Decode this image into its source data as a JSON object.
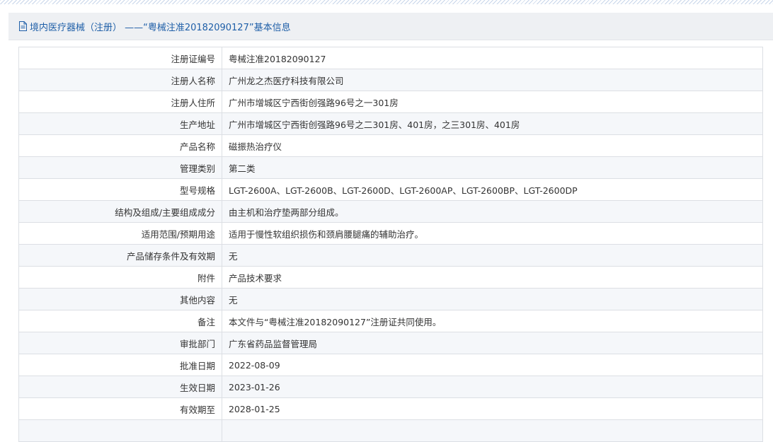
{
  "header": {
    "title": "境内医疗器械（注册） ——“粤械注准20182090127”基本信息"
  },
  "rows": [
    {
      "label": "注册证编号",
      "value": "粤械注准20182090127"
    },
    {
      "label": "注册人名称",
      "value": "广州龙之杰医疗科技有限公司"
    },
    {
      "label": "注册人住所",
      "value": "广州市增城区宁西街创强路96号之一301房"
    },
    {
      "label": "生产地址",
      "value": "广州市增城区宁西街创强路96号之二301房、401房，之三301房、401房"
    },
    {
      "label": "产品名称",
      "value": "磁振热治疗仪"
    },
    {
      "label": "管理类别",
      "value": "第二类"
    },
    {
      "label": "型号规格",
      "value": "LGT-2600A、LGT-2600B、LGT-2600D、LGT-2600AP、LGT-2600BP、LGT-2600DP"
    },
    {
      "label": "结构及组成/主要组成成分",
      "value": "由主机和治疗垫两部分组成。"
    },
    {
      "label": "适用范围/预期用途",
      "value": "适用于慢性软组织损伤和颈肩腰腿痛的辅助治疗。"
    },
    {
      "label": "产品储存条件及有效期",
      "value": "无"
    },
    {
      "label": "附件",
      "value": "产品技术要求"
    },
    {
      "label": "其他内容",
      "value": "无"
    },
    {
      "label": "备注",
      "value": "本文件与“粤械注准20182090127”注册证共同使用。"
    },
    {
      "label": "审批部门",
      "value": "广东省药品监督管理局"
    },
    {
      "label": "批准日期",
      "value": "2022-08-09"
    },
    {
      "label": "生效日期",
      "value": "2023-01-26"
    },
    {
      "label": "有效期至",
      "value": "2028-01-25"
    },
    {
      "label": "",
      "value": ""
    }
  ]
}
